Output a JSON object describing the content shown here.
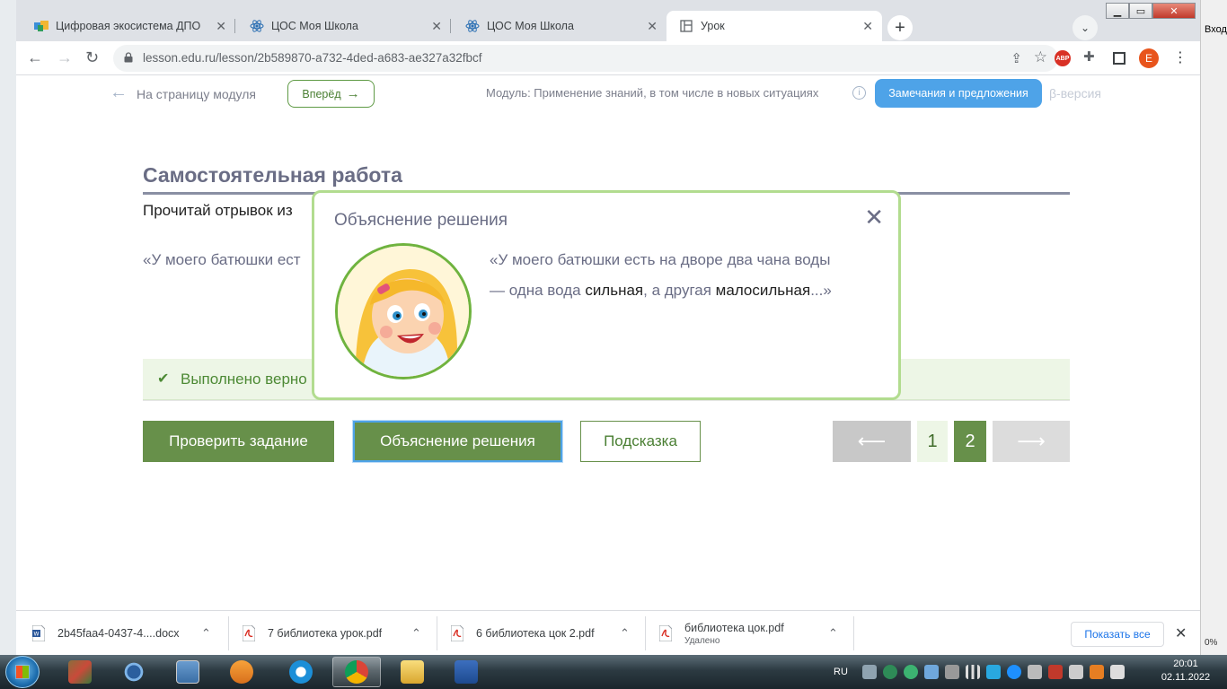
{
  "desktop": {
    "right_label": "Вход",
    "right_percent": "0%"
  },
  "browser": {
    "tabs": [
      {
        "title": "Цифровая экосистема ДПО",
        "icon": "dpo-favicon",
        "active": false
      },
      {
        "title": "ЦОС Моя Школа",
        "icon": "react-favicon",
        "active": false
      },
      {
        "title": "ЦОС Моя Школа",
        "icon": "react-favicon",
        "active": false
      },
      {
        "title": "Урок",
        "icon": "page-favicon",
        "active": true
      }
    ],
    "new_tab": "+",
    "url": "lesson.edu.ru/lesson/2b589870-a732-4ded-a683-ae327a32fbcf",
    "abp_label": "ABP",
    "profile_initial": "E"
  },
  "lesson": {
    "back_label": "На страницу модуля",
    "forward_label": "Вперёд",
    "module_label": "Модуль: Применение знаний, в том числе в новых ситуациях",
    "info_icon": "i",
    "feedback_label": "Замечания и предложения",
    "beta_label": "β-версия",
    "section_title": "Самостоятельная работа",
    "instruction": "Прочитай отрывок из",
    "quote_start": "«У моего батюшки ест",
    "success_text": "Выполнено верно",
    "buttons": {
      "check": "Проверить задание",
      "explain": "Объяснение решения",
      "hint": "Подсказка"
    },
    "pagination": {
      "prev": "⟵",
      "pages": [
        "1",
        "2"
      ],
      "current": "2",
      "next": "⟶"
    }
  },
  "modal": {
    "title": "Объяснение решения",
    "close": "✕",
    "text_part1": "«У моего батюшки есть на дворе два чана воды — одна вода ",
    "bold1": "сильная",
    "text_part2": ", а другая ",
    "bold2": "малосильная",
    "text_part3": "...»"
  },
  "downloads": {
    "items": [
      {
        "name": "2b45faa4-0437-4....docx",
        "type": "word",
        "sub": ""
      },
      {
        "name": "7 библиотека урок.pdf",
        "type": "pdf",
        "sub": ""
      },
      {
        "name": "6 библиотека цок 2.pdf",
        "type": "pdf",
        "sub": ""
      },
      {
        "name": "библиотека цок.pdf",
        "type": "pdf",
        "sub": "Удалено"
      }
    ],
    "show_all": "Показать все"
  },
  "taskbar": {
    "apps": [
      "office-tools",
      "sync",
      "image-viewer",
      "media-player",
      "internet-explorer",
      "chrome",
      "file-explorer",
      "word"
    ],
    "active_app": "chrome",
    "lang": "RU",
    "time": "20:01",
    "date": "02.11.2022"
  },
  "colors": {
    "accent_green": "#67904a",
    "accent_blue": "#4ea3e8",
    "modal_border": "#b2dc8f"
  }
}
